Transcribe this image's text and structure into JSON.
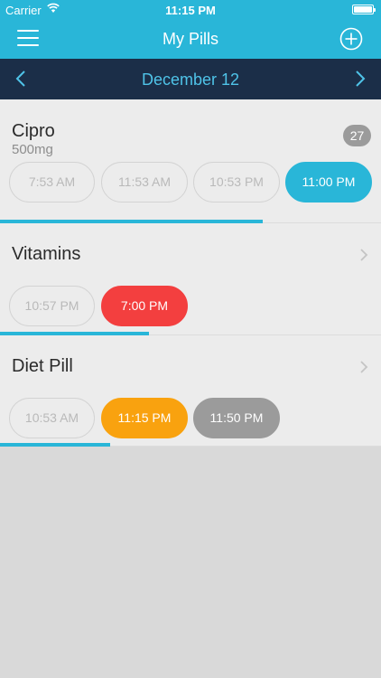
{
  "status_bar": {
    "carrier": "Carrier",
    "time": "11:15 PM"
  },
  "header": {
    "title": "My Pills",
    "menu_icon": "hamburger-icon",
    "add_icon": "plus-circle-icon"
  },
  "date_bar": {
    "date": "December 12"
  },
  "colors": {
    "accent": "#29b6d8",
    "navy": "#1b2e48",
    "missed": "#f33f3f",
    "due": "#f9a20f",
    "upcoming": "#9b9b9b"
  },
  "pills": [
    {
      "name": "Cipro",
      "dose": "500mg",
      "badge": "27",
      "progress": 0.69,
      "times": [
        {
          "label": "7:53 AM",
          "state": "past"
        },
        {
          "label": "11:53 AM",
          "state": "past"
        },
        {
          "label": "10:53 PM",
          "state": "past"
        },
        {
          "label": "11:00 PM",
          "state": "taken"
        }
      ]
    },
    {
      "name": "Vitamins",
      "progress": 0.39,
      "times": [
        {
          "label": "10:57 PM",
          "state": "past"
        },
        {
          "label": "7:00 PM",
          "state": "missed"
        }
      ]
    },
    {
      "name": "Diet Pill",
      "progress": 0.29,
      "times": [
        {
          "label": "10:53 AM",
          "state": "past"
        },
        {
          "label": "11:15 PM",
          "state": "due"
        },
        {
          "label": "11:50 PM",
          "state": "upcoming"
        }
      ]
    }
  ]
}
